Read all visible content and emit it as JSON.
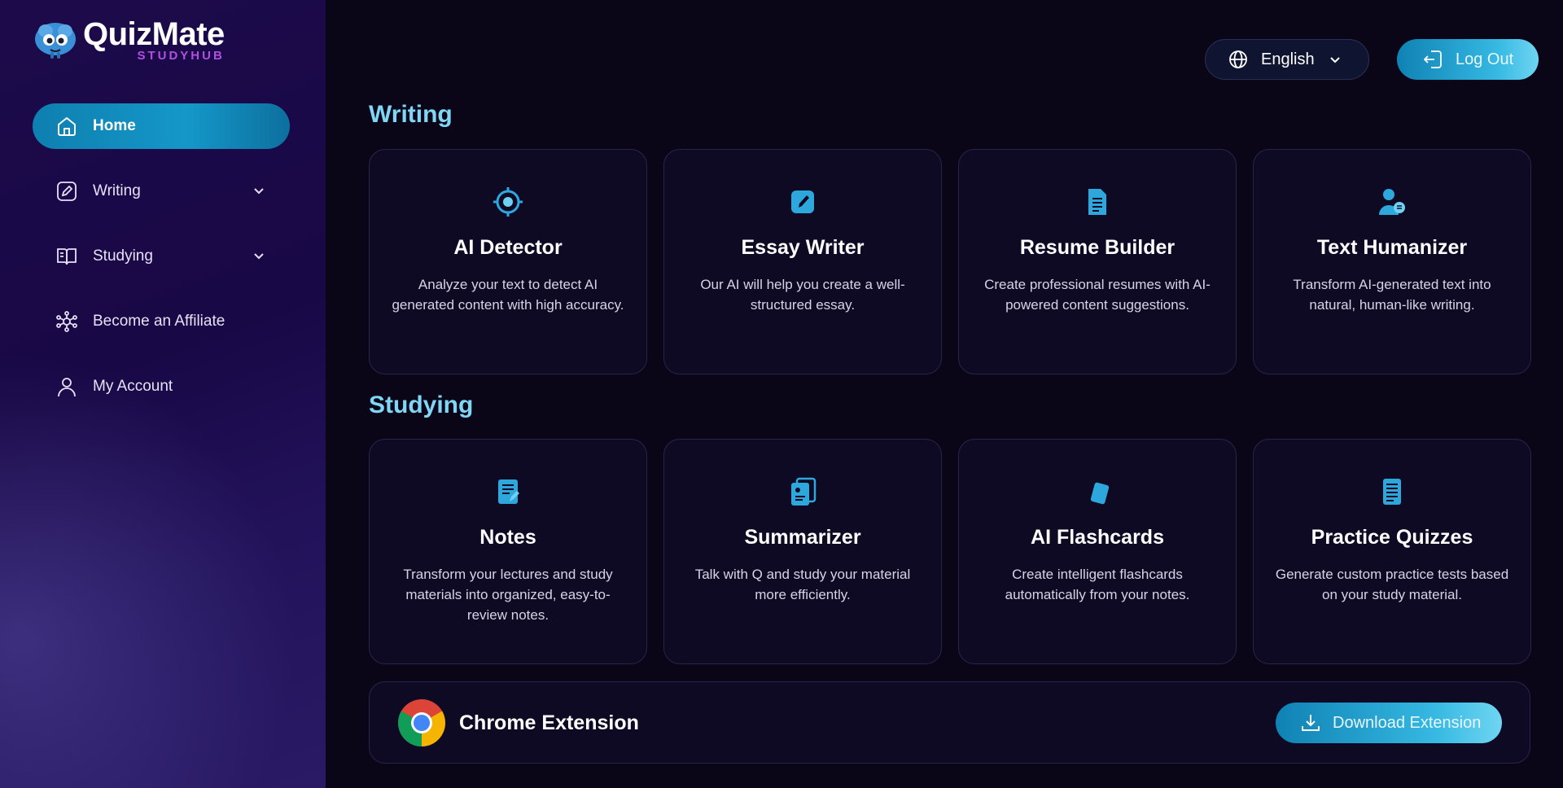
{
  "brand": {
    "name": "QuizMate",
    "subtitle": "STUDYHUB"
  },
  "sidebar": {
    "items": [
      {
        "label": "Home",
        "icon": "home-icon",
        "active": true
      },
      {
        "label": "Writing",
        "icon": "pencil-icon",
        "expandable": true
      },
      {
        "label": "Studying",
        "icon": "book-icon",
        "expandable": true
      },
      {
        "label": "Become an Affiliate",
        "icon": "network-icon"
      },
      {
        "label": "My Account",
        "icon": "user-icon"
      }
    ]
  },
  "header": {
    "language": "English",
    "logout_label": "Log Out"
  },
  "sections": {
    "writing": {
      "title": "Writing",
      "cards": [
        {
          "title": "AI Detector",
          "desc": "Analyze your text to detect AI generated content with high accuracy.",
          "icon": "target-icon"
        },
        {
          "title": "Essay Writer",
          "desc": "Our AI will help you create a well-structured essay.",
          "icon": "pen-square-icon"
        },
        {
          "title": "Resume Builder",
          "desc": "Create professional resumes with AI-powered content suggestions.",
          "icon": "document-icon"
        },
        {
          "title": "Text Humanizer",
          "desc": "Transform AI-generated text into natural, human-like writing.",
          "icon": "person-chat-icon"
        }
      ]
    },
    "studying": {
      "title": "Studying",
      "cards": [
        {
          "title": "Notes",
          "desc": "Transform your lectures and study materials into organized, easy-to-review notes.",
          "icon": "notes-icon"
        },
        {
          "title": "Summarizer",
          "desc": "Talk with Q and study your material more efficiently.",
          "icon": "summary-icon"
        },
        {
          "title": "AI Flashcards",
          "desc": "Create intelligent flashcards automatically from your notes.",
          "icon": "flashcards-icon"
        },
        {
          "title": "Practice Quizzes",
          "desc": "Generate custom practice tests based on your study material.",
          "icon": "quiz-icon"
        }
      ]
    }
  },
  "extension": {
    "title": "Chrome Extension",
    "button_label": "Download Extension"
  },
  "colors": {
    "accent": "#1498c8",
    "heading": "#7fd6f5",
    "brand_sub": "#b04fe0"
  }
}
